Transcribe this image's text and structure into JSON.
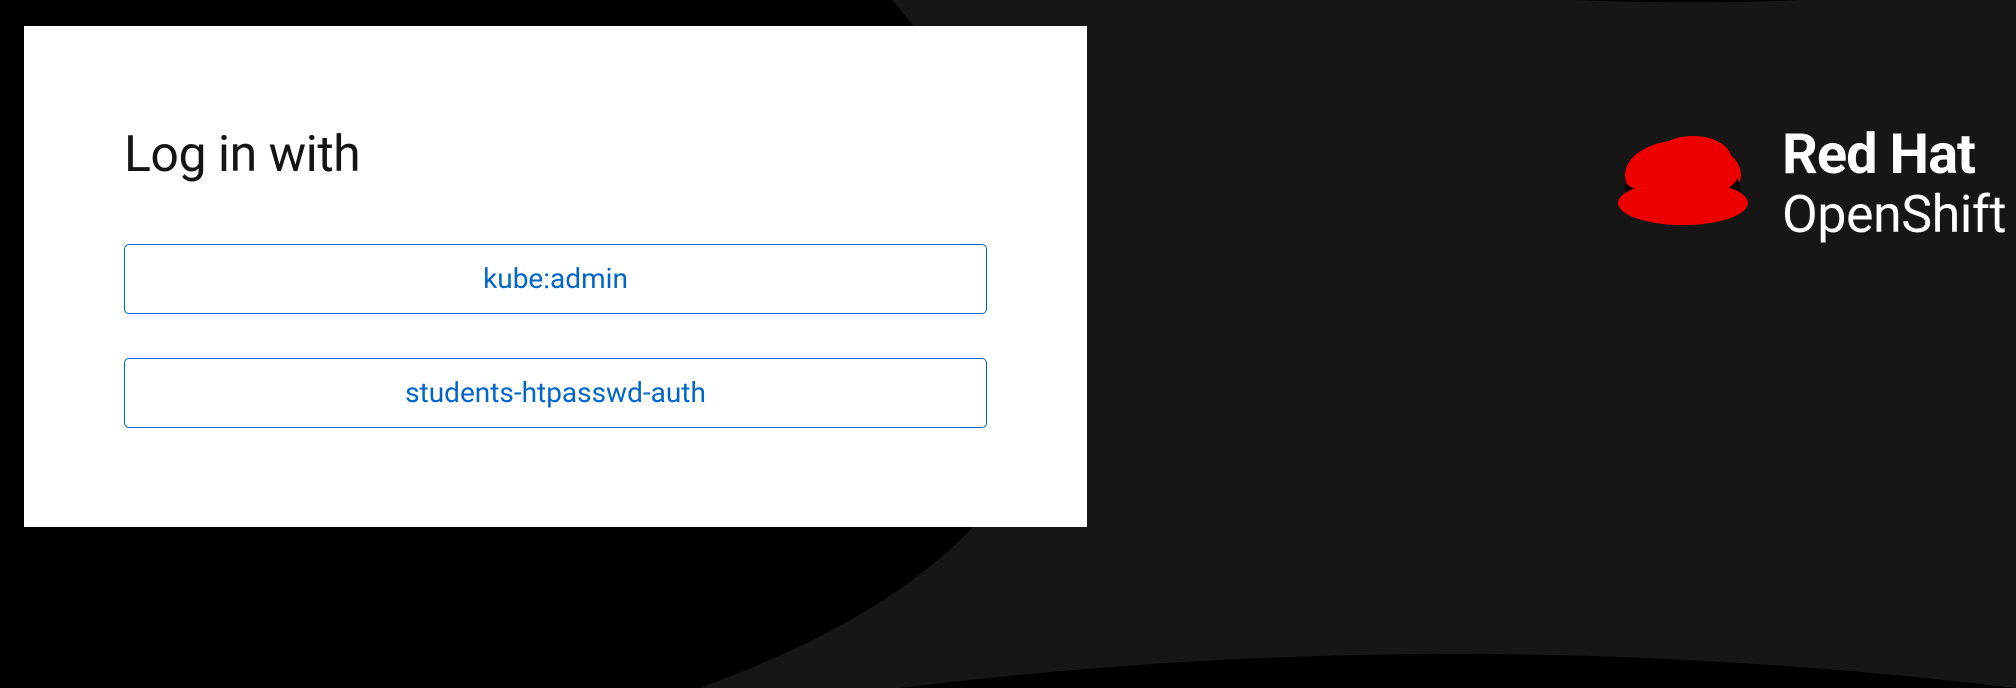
{
  "login": {
    "heading": "Log in with",
    "providers": [
      {
        "label": "kube:admin"
      },
      {
        "label": "students-htpasswd-auth"
      }
    ]
  },
  "brand": {
    "line1": "Red Hat",
    "line2": "OpenShift"
  },
  "colors": {
    "accent": "#0066cc",
    "brand_red": "#ee0000",
    "bg_dark": "#000000",
    "bg_swoosh": "#1a1a1a"
  }
}
